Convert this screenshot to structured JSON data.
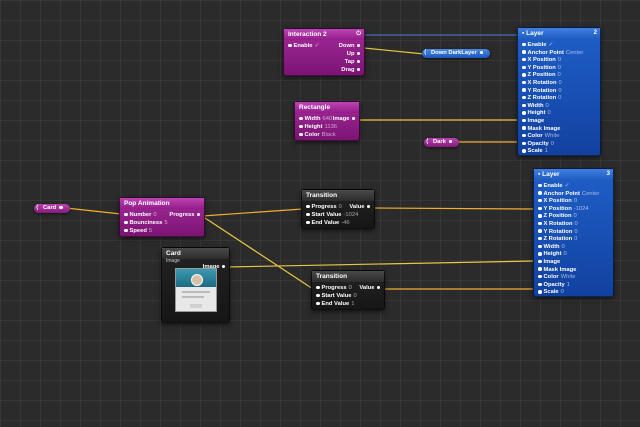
{
  "colors": {
    "canvas": "#2b2b2b",
    "patch_purple": "#931c8a",
    "patch_blue": "#1f5cc0",
    "patch_dark": "#2c2c2c",
    "wire_orange": "#f0b030",
    "wire_yellow": "#e8c840",
    "wire_blue": "#4d7fd6"
  },
  "interaction": {
    "title": "Interaction 2",
    "icon": "power-icon",
    "ports_in": [
      {
        "label": "Enable",
        "value": "✓"
      }
    ],
    "ports_out": [
      "Down",
      "Up",
      "Tap",
      "Drag"
    ]
  },
  "rectangle": {
    "title": "Rectangle",
    "ports_in": [
      {
        "label": "Width",
        "value": "640"
      },
      {
        "label": "Height",
        "value": "1136"
      },
      {
        "label": "Color",
        "value": "Black"
      }
    ],
    "ports_out": [
      "Image"
    ]
  },
  "layer1": {
    "title": "Layer",
    "number": "2",
    "icon": "layer-icon",
    "ports_in": [
      {
        "label": "Enable",
        "value": "✓"
      },
      {
        "label": "Anchor Point",
        "value": "Center"
      },
      {
        "label": "X Position",
        "value": "0"
      },
      {
        "label": "Y Position",
        "value": "0"
      },
      {
        "label": "Z Position",
        "value": "0"
      },
      {
        "label": "X Rotation",
        "value": "0"
      },
      {
        "label": "Y Rotation",
        "value": "0"
      },
      {
        "label": "Z Rotation",
        "value": "0"
      },
      {
        "label": "Width",
        "value": "0"
      },
      {
        "label": "Height",
        "value": "0"
      },
      {
        "label": "Image",
        "value": ""
      },
      {
        "label": "Mask Image",
        "value": ""
      },
      {
        "label": "Color",
        "value": "White"
      },
      {
        "label": "Opacity",
        "value": "0"
      },
      {
        "label": "Scale",
        "value": "1"
      }
    ]
  },
  "layer2": {
    "title": "Layer",
    "number": "3",
    "icon": "layer-icon",
    "ports_in": [
      {
        "label": "Enable",
        "value": "✓"
      },
      {
        "label": "Anchor Point",
        "value": "Center"
      },
      {
        "label": "X Position",
        "value": "0"
      },
      {
        "label": "Y Position",
        "value": "-1024"
      },
      {
        "label": "Z Position",
        "value": "0"
      },
      {
        "label": "X Rotation",
        "value": "0"
      },
      {
        "label": "Y Rotation",
        "value": "0"
      },
      {
        "label": "Z Rotation",
        "value": "0"
      },
      {
        "label": "Width",
        "value": "0"
      },
      {
        "label": "Height",
        "value": "0"
      },
      {
        "label": "Image",
        "value": ""
      },
      {
        "label": "Mask Image",
        "value": ""
      },
      {
        "label": "Color",
        "value": "White"
      },
      {
        "label": "Opacity",
        "value": "1"
      },
      {
        "label": "Scale",
        "value": "0"
      }
    ]
  },
  "pop_animation": {
    "title": "Pop Animation",
    "ports_in": [
      {
        "label": "Number",
        "value": "0"
      },
      {
        "label": "Bounciness",
        "value": "5"
      },
      {
        "label": "Speed",
        "value": "5"
      }
    ],
    "ports_out": [
      "Progress"
    ]
  },
  "transition1": {
    "title": "Transition",
    "ports_in": [
      {
        "label": "Progress",
        "value": "0"
      },
      {
        "label": "Start Value",
        "value": "-1024"
      },
      {
        "label": "End Value",
        "value": "-46"
      }
    ],
    "ports_out": [
      "Value"
    ]
  },
  "transition2": {
    "title": "Transition",
    "ports_in": [
      {
        "label": "Progress",
        "value": "0"
      },
      {
        "label": "Start Value",
        "value": "0"
      },
      {
        "label": "End Value",
        "value": "1"
      }
    ],
    "ports_out": [
      "Value"
    ]
  },
  "card_image": {
    "title": "Card",
    "subtitle": "Image",
    "ports_out": [
      "Image"
    ]
  },
  "pills": {
    "card": "Card",
    "dark": "Dark",
    "down_darklayer": "Down DarkLayer"
  }
}
